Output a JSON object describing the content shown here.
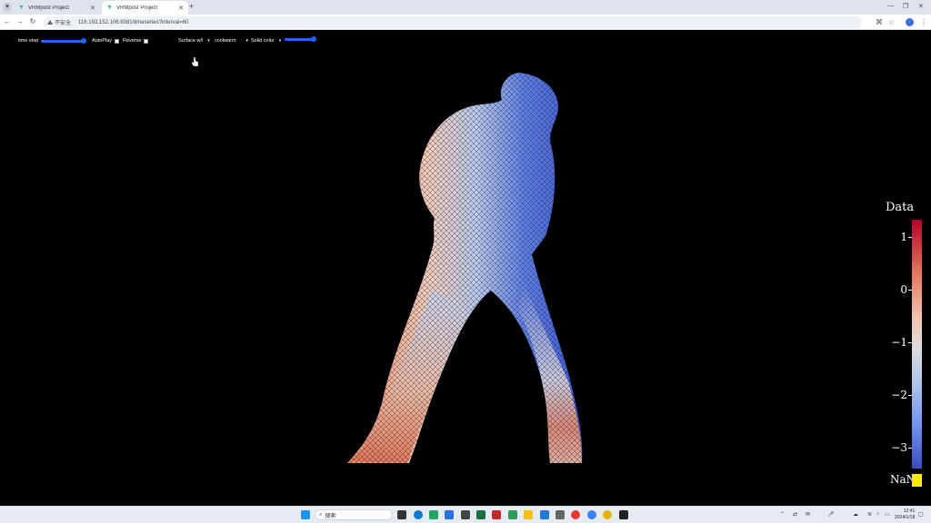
{
  "browser": {
    "tabs": [
      {
        "title": "VRMpost Project",
        "active": false
      },
      {
        "title": "VRMpost Project",
        "active": true
      }
    ],
    "security_label": "不安全",
    "url": "116.193.152.106:8081/timeseries?interval=60"
  },
  "controls": {
    "time_step_label": "time step",
    "time_step_value": 1.0,
    "autoplay_label": "AutoPlay",
    "reverse_label": "Reverse",
    "surface_mode": "Surface w/l",
    "colormap": "coolwarm",
    "color_mode": "Solid color",
    "opacity_value": 1.0
  },
  "colorbar": {
    "title": "Data",
    "ticks": [
      "1",
      "0",
      "−1",
      "−2",
      "−3"
    ],
    "nan_label": "NaN",
    "nan_color": "#ffea00",
    "colormap": "coolwarm"
  },
  "taskbar": {
    "search_label": "搜索",
    "clock_time": "12:41",
    "clock_date": "2024/1/18"
  },
  "colors": {
    "accent": "#1e66f5",
    "background": "#000000"
  }
}
